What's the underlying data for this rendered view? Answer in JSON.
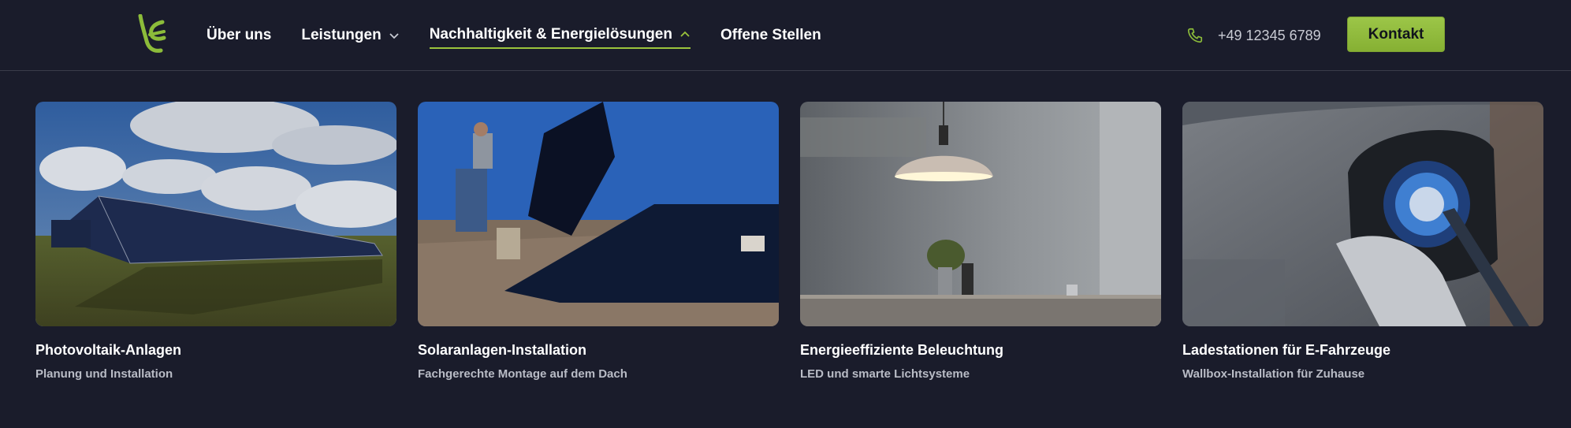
{
  "header": {
    "nav": [
      {
        "label": "Über uns",
        "has_dropdown": false
      },
      {
        "label": "Leistungen",
        "has_dropdown": true,
        "chevron": "chevron-down-icon"
      },
      {
        "label": "Nachhaltigkeit & Energielösungen",
        "has_dropdown": true,
        "chevron": "chevron-up-icon",
        "active": true
      },
      {
        "label": "Offene Stellen",
        "has_dropdown": false
      }
    ],
    "phone": {
      "icon": "phone-icon",
      "number": "+49 12345 6789"
    },
    "cta_label": "Kontakt"
  },
  "colors": {
    "background": "#1a1c2b",
    "accent": "#9bc43c",
    "button": "#8db83a",
    "subtext": "#b9bcc6"
  },
  "cards": [
    {
      "title": "Photovoltaik-Anlagen",
      "subtitle": "Planung und Installation",
      "image": "solar-field-photo"
    },
    {
      "title": "Solaranlagen-Installation",
      "subtitle": "Fachgerechte Montage auf dem Dach",
      "image": "roof-installation-photo"
    },
    {
      "title": "Energieeffiziente Beleuchtung",
      "subtitle": "LED und smarte Lichtsysteme",
      "image": "pendant-lamp-photo"
    },
    {
      "title": "Ladestationen für E-Fahrzeuge",
      "subtitle": "Wallbox-Installation für Zuhause",
      "image": "ev-charger-photo"
    }
  ]
}
